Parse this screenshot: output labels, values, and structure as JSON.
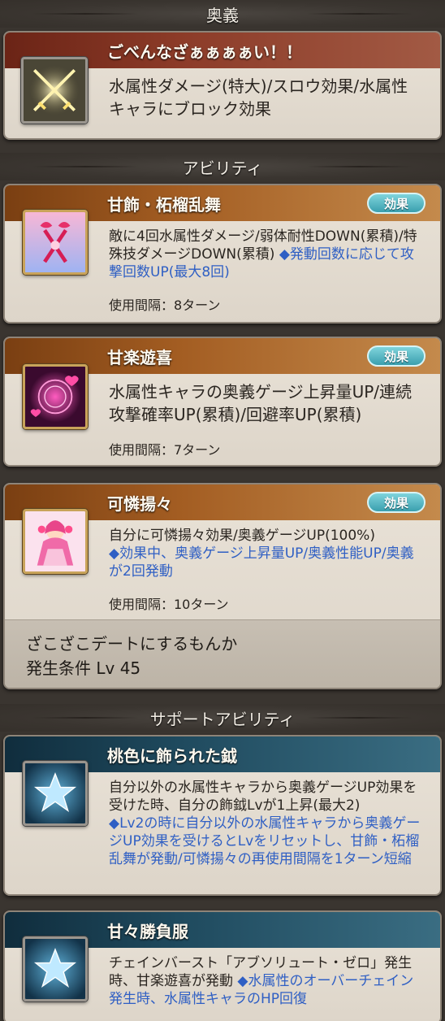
{
  "sections": {
    "ougi": "奥義",
    "abilities": "アビリティ",
    "support": "サポートアビリティ"
  },
  "ougi": {
    "name": "ごべんなざぁぁぁぁい！！",
    "desc": "水属性ダメージ(特大)/スロウ効果/水属性キャラにブロック効果",
    "icon": "crossed-swords-icon"
  },
  "abilities": [
    {
      "name": "甘飾・柘榴乱舞",
      "badge": "効果",
      "desc": "敵に4回水属性ダメージ/弱体耐性DOWN(累積)/特殊技ダメージDOWN(累積)",
      "desc_hl": "◆発動回数に応じて攻撃回数UP(最大8回)",
      "cooldown": "使用間隔：8ターン",
      "icon": "ribbon-weapon-icon"
    },
    {
      "name": "甘楽遊喜",
      "badge": "効果",
      "desc": "水属性キャラの奥義ゲージ上昇量UP/連続攻撃確率UP(累積)/回避率UP(累積)",
      "cooldown": "使用間隔：7ターン",
      "icon": "heart-sparkle-icon"
    },
    {
      "name": "可憐揚々",
      "badge": "効果",
      "desc": "自分に可憐揚々効果/奥義ゲージUP(100%)",
      "desc_hl": "◆効果中、奥義ゲージ上昇量UP/奥義性能UP/奥義が2回発動",
      "cooldown": "使用間隔：10ターン",
      "icon": "character-portrait-icon",
      "condition_name": "ざこざこデートにするもんか",
      "condition_level": "発生条件 Lv 45"
    }
  ],
  "support": [
    {
      "name": "桃色に飾られた鉞",
      "desc": "自分以外の水属性キャラから奥義ゲージUP効果を受けた時、自分の飾鉞Lvが1上昇(最大2)",
      "desc_hl": "◆Lv2の時に自分以外の水属性キャラから奥義ゲージUP効果を受けるとLvをリセットし、甘飾・柘榴乱舞が発動/可憐揚々の再使用間隔を1ターン短縮",
      "icon": "star-icon"
    },
    {
      "name": "甘々勝負服",
      "desc": "チェインバースト「アブソリュート・ゼロ」発生時、甘楽遊喜が発動",
      "desc_hl": "◆水属性のオーバーチェイン発生時、水属性キャラのHP回復",
      "icon": "star-icon"
    }
  ]
}
